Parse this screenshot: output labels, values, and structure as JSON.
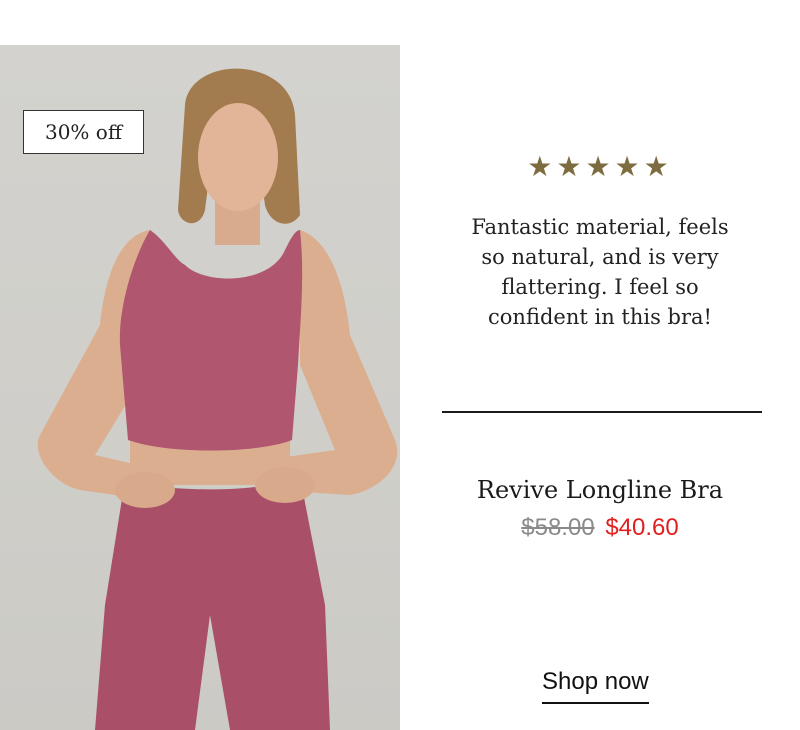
{
  "promo": {
    "badge_label": "30% off",
    "badge_icon": "none"
  },
  "product_image": {
    "garment_color": "#b0566e",
    "background_color": "#d0cfca"
  },
  "review": {
    "rating": 5,
    "rating_max": 5,
    "stars_text": "★★★★★",
    "star_color": "#7d6c3f",
    "text": "Fantastic material, feels so natural, and is very flattering. I feel so confident in this bra!"
  },
  "product": {
    "name": "Revive Longline Bra",
    "original_price": "$58.00",
    "sale_price": "$40.60",
    "sale_color": "#e02020"
  },
  "cta": {
    "label": "Shop now"
  }
}
